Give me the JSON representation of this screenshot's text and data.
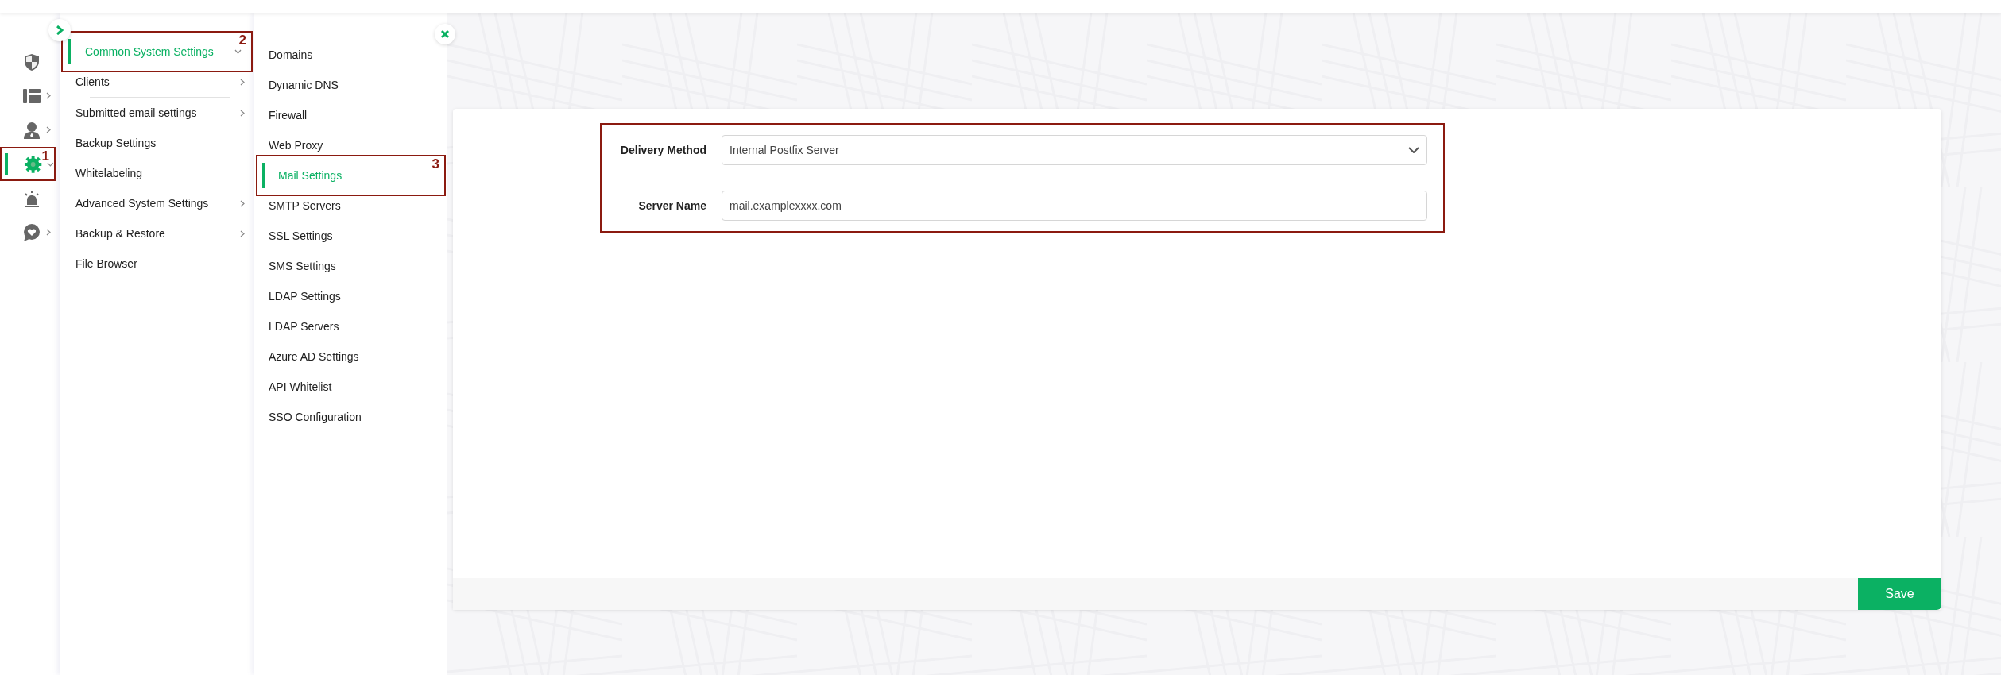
{
  "rail": [
    {
      "kind": "shield",
      "selected": false
    },
    {
      "kind": "layout",
      "selected": false,
      "expandable": true,
      "expanded": false
    },
    {
      "kind": "user",
      "selected": false,
      "expandable": true,
      "expanded": false
    },
    {
      "kind": "gear",
      "selected": true,
      "expandable": true,
      "expanded": true,
      "annotation": "1"
    },
    {
      "kind": "alarm",
      "selected": false
    },
    {
      "kind": "chat-heart",
      "selected": false,
      "expandable": true,
      "expanded": false
    }
  ],
  "menu": [
    {
      "label": "Common System Settings",
      "selected": true,
      "expandable": true,
      "expanded": true,
      "annotation": "2"
    },
    {
      "label": "Clients",
      "selected": false,
      "expandable": true,
      "expanded": false,
      "separator_below": true
    },
    {
      "label": "Submitted email settings",
      "selected": false,
      "expandable": true,
      "expanded": false
    },
    {
      "label": "Backup Settings",
      "selected": false
    },
    {
      "label": "Whitelabeling",
      "selected": false
    },
    {
      "label": "Advanced System Settings",
      "selected": false,
      "expandable": true,
      "expanded": false
    },
    {
      "label": "Backup & Restore",
      "selected": false,
      "expandable": true,
      "expanded": false
    },
    {
      "label": "File Browser",
      "selected": false
    }
  ],
  "submenu": [
    {
      "label": "Domains",
      "selected": false
    },
    {
      "label": "Dynamic DNS",
      "selected": false
    },
    {
      "label": "Firewall",
      "selected": false
    },
    {
      "label": "Web Proxy",
      "selected": false
    },
    {
      "label": "Mail Settings",
      "selected": true,
      "annotation": "3"
    },
    {
      "label": "SMTP Servers",
      "selected": false
    },
    {
      "label": "SSL Settings",
      "selected": false
    },
    {
      "label": "SMS Settings",
      "selected": false
    },
    {
      "label": "LDAP Settings",
      "selected": false
    },
    {
      "label": "LDAP Servers",
      "selected": false
    },
    {
      "label": "Azure AD Settings",
      "selected": false
    },
    {
      "label": "API Whitelist",
      "selected": false
    },
    {
      "label": "SSO Configuration",
      "selected": false
    }
  ],
  "form": {
    "fields": [
      {
        "label": "Delivery Method",
        "kind": "select",
        "value": "Internal Postfix Server"
      },
      {
        "label": "Server Name",
        "kind": "text",
        "value": "mail.examplexxxx.com"
      }
    ]
  },
  "save_button": "Save"
}
